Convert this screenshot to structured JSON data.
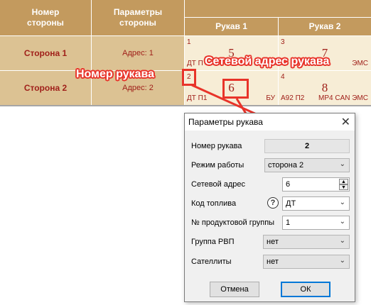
{
  "table": {
    "headers": {
      "side_number": "Номер стороны",
      "side_params": "Параметры стороны",
      "hose1": "Рукав 1",
      "hose2": "Рукав 2"
    },
    "rows": [
      {
        "side": "Сторона 1",
        "address": "Адрес: 1",
        "hoses": [
          {
            "num": "1",
            "net_addr": "5",
            "fuel": "ДТ П",
            "fuel2": ""
          },
          {
            "num": "3",
            "net_addr": "7",
            "fuel": "",
            "fuel2": "ЭМС"
          }
        ]
      },
      {
        "side": "Сторона 2",
        "address": "Адрес: 2",
        "hoses": [
          {
            "num": "2",
            "net_addr": "6",
            "fuel": "ДТ П1",
            "fuel2": "БУ"
          },
          {
            "num": "4",
            "net_addr": "8",
            "fuel": "А92 П2",
            "fuel2": "МР4 CAN ЭМС"
          }
        ]
      }
    ]
  },
  "annotations": {
    "hose_number": "Номер рукава",
    "network_address": "Сетевой адрес рукава",
    "color": "#e8342a"
  },
  "dialog": {
    "title": "Параметры рукава",
    "fields": {
      "hose_number": {
        "label": "Номер рукава",
        "value": "2"
      },
      "mode": {
        "label": "Режим работы",
        "value": "сторона 2"
      },
      "net_address": {
        "label": "Сетевой адрес",
        "value": "6"
      },
      "fuel_code": {
        "label": "Код топлива",
        "value": "ДТ"
      },
      "product_group": {
        "label": "№ продуктовой группы",
        "value": "1"
      },
      "rvp_group": {
        "label": "Группа РВП",
        "value": "нет"
      },
      "satellites": {
        "label": "Сателлиты",
        "value": "нет"
      }
    },
    "buttons": {
      "cancel": "Отмена",
      "ok": "ОК"
    }
  }
}
